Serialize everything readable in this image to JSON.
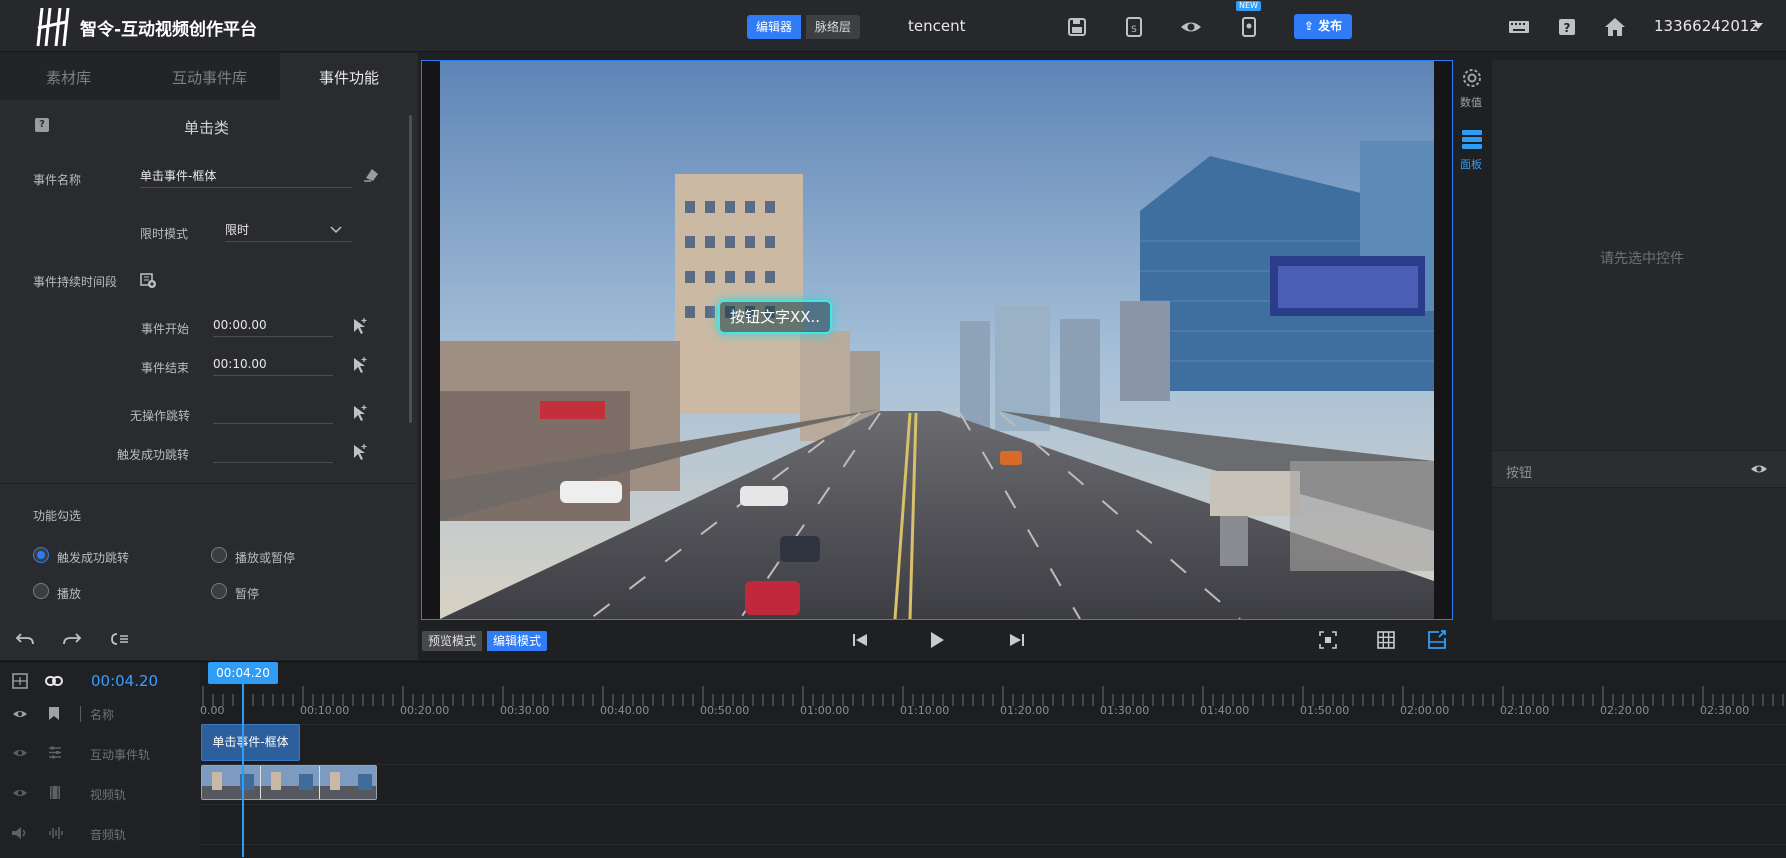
{
  "topbar": {
    "title": "智令-互动视频创作平台",
    "mode_editor": "编辑器",
    "mode_network": "脉络层",
    "project_name": "tencent",
    "new_badge": "NEW",
    "publish_label": "发布",
    "user": "13366242012"
  },
  "left_panel": {
    "tabs": [
      "素材库",
      "互动事件库",
      "事件功能"
    ],
    "active_tab": "事件功能",
    "section_title": "单击类",
    "event_name_label": "事件名称",
    "event_name_value": "单击事件-框体",
    "limit_mode_label": "限时模式",
    "limit_mode_value": "限时",
    "duration_label": "事件持续时间段",
    "start_label": "事件开始",
    "start_value": "00:00.00",
    "end_label": "事件结束",
    "end_value": "00:10.00",
    "no_action_jump_label": "无操作跳转",
    "no_action_jump_value": "",
    "success_jump_label": "触发成功跳转",
    "success_jump_value": "",
    "func_title": "功能勾选",
    "options": [
      {
        "label": "触发成功跳转",
        "checked": true
      },
      {
        "label": "播放或暂停",
        "checked": false
      },
      {
        "label": "播放",
        "checked": false
      },
      {
        "label": "暂停",
        "checked": false
      }
    ]
  },
  "stage": {
    "hotspot_label": "按钮文字XX..",
    "preview_mode": "预览模式",
    "edit_mode": "编辑模式"
  },
  "right_tools": {
    "values_label": "数值",
    "panel_label": "面板"
  },
  "right_panel": {
    "hint": "请先选中控件",
    "layer_label": "按钮"
  },
  "timeline": {
    "current_time": "00:04.20",
    "playhead_label": "00:04.20",
    "name_header": "名称",
    "tracks": [
      "互动事件轨",
      "视频轨",
      "音频轨"
    ],
    "event_clip_label": "单击事件-框体",
    "ruler_labels": [
      "0.00",
      "00:10.00",
      "00:20.00",
      "00:30.00",
      "00:40.00",
      "00:50.00",
      "01:00.00",
      "01:10.00",
      "01:20.00",
      "01:30.00",
      "01:40.00",
      "01:50.00",
      "02:00.00",
      "02:10.00",
      "02:20.00",
      "02:30.00"
    ]
  },
  "colors": {
    "accent": "#2f7cf6",
    "playhead": "#2f9df6",
    "hotspot_glow": "#47e3e6"
  }
}
